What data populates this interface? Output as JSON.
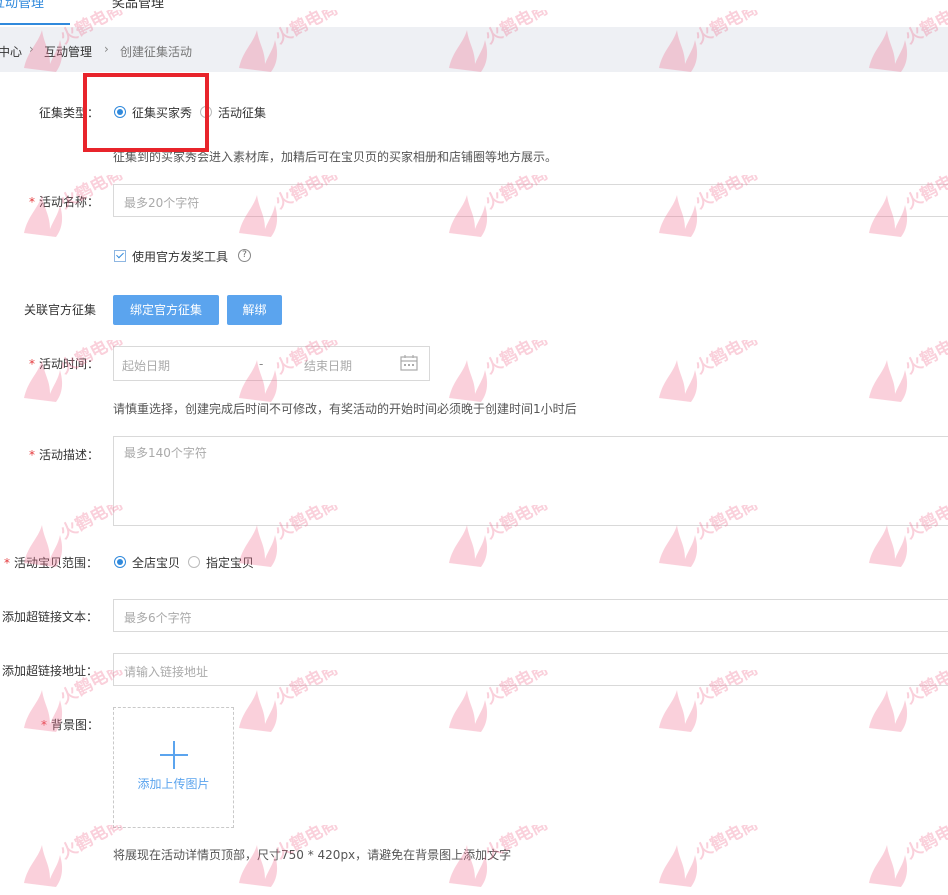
{
  "tabs": [
    {
      "label": "互动管理",
      "active": true
    },
    {
      "label": "奖品管理",
      "active": false
    }
  ],
  "breadcrumb": [
    "中心",
    "互动管理",
    "创建征集活动"
  ],
  "form": {
    "collect_type": {
      "label": "征集类型：",
      "options": [
        "征集买家秀",
        "活动征集"
      ],
      "selected": "征集买家秀",
      "hint": "征集到的买家秀会进入素材库，加精后可在宝贝页的买家相册和店铺圈等地方展示。"
    },
    "activity_name": {
      "label": "活动名称：",
      "required": true,
      "placeholder": "最多20个字符"
    },
    "official_tool": {
      "label": "使用官方发奖工具",
      "checked": true
    },
    "link_official": {
      "label": "关联官方征集",
      "bind_button": "绑定官方征集",
      "unbind_button": "解绑"
    },
    "activity_time": {
      "label": "活动时间：",
      "required": true,
      "start_placeholder": "起始日期",
      "end_placeholder": "结束日期",
      "separator": "-",
      "hint": "请慎重选择，创建完成后时间不可修改，有奖活动的开始时间必须晚于创建时间1小时后"
    },
    "activity_desc": {
      "label": "活动描述：",
      "required": true,
      "placeholder": "最多140个字符"
    },
    "item_range": {
      "label": "活动宝贝范围：",
      "required": true,
      "options": [
        "全店宝贝",
        "指定宝贝"
      ],
      "selected": "全店宝贝"
    },
    "link_text": {
      "label": "添加超链接文本：",
      "placeholder": "最多6个字符"
    },
    "link_url": {
      "label": "添加超链接地址：",
      "placeholder": "请输入链接地址"
    },
    "background": {
      "label": "背景图：",
      "required": true,
      "upload_label": "添加上传图片",
      "hint": "将展现在活动详情页顶部，尺寸750 * 420px，请避免在背景图上添加文字"
    }
  },
  "watermark": {
    "text": "火鹤电商",
    "color": "#f07090"
  },
  "colors": {
    "accent": "#3089dc",
    "button": "#5ba4ee",
    "highlight_box": "#e8242b",
    "required": "#e4393c"
  }
}
